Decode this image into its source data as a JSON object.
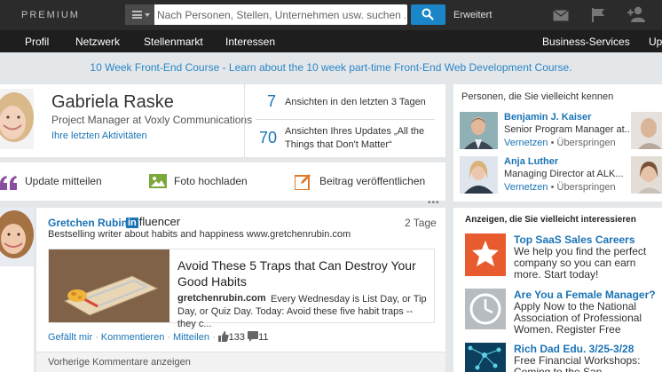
{
  "topbar": {
    "logo": "PREMIUM",
    "search_placeholder": "Nach Personen, Stellen, Unternehmen usw. suchen ...",
    "advanced": "Erweitert"
  },
  "nav": {
    "items": [
      "Profil",
      "Netzwerk",
      "Stellenmarkt",
      "Interessen"
    ],
    "right_items": [
      "Business-Services",
      "Upg"
    ]
  },
  "banner": {
    "text": "10 Week Front-End Course - Learn about the 10 week part-time Front-End Web Development Course."
  },
  "profile": {
    "name": "Gabriela Raske",
    "title": "Project Manager at Voxly Communications",
    "activity_link": "Ihre letzten Aktivitäten",
    "stats": [
      {
        "count": "7",
        "label": "Ansichten in den letzten 3 Tagen"
      },
      {
        "count": "70",
        "label": "Ansichten Ihres Updates „All the Things that Don't Matter“"
      }
    ]
  },
  "actions": {
    "update": "Update mitteilen",
    "photo": "Foto hochladen",
    "post": "Beitrag veröffentlichen"
  },
  "pymk": {
    "heading": "Personen, die Sie vielleicht kennen",
    "people": [
      {
        "name": "Benjamin J. Kaiser",
        "title": "Senior Program Manager at...",
        "connect": "Vernetzen",
        "skip": "Überspringen"
      },
      {
        "name": "Anja Luther",
        "title": "Managing Director at ALK...",
        "connect": "Vernetzen",
        "skip": "Überspringen"
      }
    ]
  },
  "feed": {
    "author": "Gretchen Rubin",
    "badge_in": "in",
    "badge_rest": "fluencer",
    "time": "2 Tage",
    "bio": "Bestselling writer about habits and happiness www.gretchenrubin.com",
    "article": {
      "title": "Avoid These 5 Traps that Can Destroy Your Good Habits",
      "domain": "gretchenrubin.com",
      "desc": "Every Wednesday is List Day, or Tip Day, or Quiz Day. Today: Avoid these five habit traps -- they c..."
    },
    "like": "Gefällt mir",
    "comment": "Kommentieren",
    "share": "Mitteilen",
    "like_count": "133",
    "comment_count": "11",
    "prev_comments": "Vorherige Kommentare anzeigen"
  },
  "ads": {
    "heading": "Anzeigen, die Sie vielleicht interessieren",
    "items": [
      {
        "title": "Top SaaS Sales Careers",
        "text": "We help you find the perfect company so you can earn more. Start today!"
      },
      {
        "title": "Are You a Female Manager?",
        "text": "Apply Now to the National Association of Professional Women. Register Free"
      },
      {
        "title": "Rich Dad Edu. 3/25-3/28",
        "text": "Free Financial Workshops: Coming to the San Francisco"
      }
    ]
  },
  "colors": {
    "accent": "#1a73b5",
    "topbar": "#2b2b2b",
    "navbar": "#1e1e1e"
  }
}
